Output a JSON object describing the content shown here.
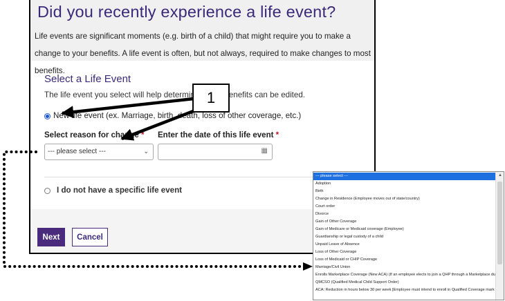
{
  "page": {
    "title": "Did you recently experience a life event?",
    "intro": "Life events are significant moments (e.g. birth of a child) that might require you to make a change to your benefits. A life event is often, but not always, required to make changes to most benefits."
  },
  "section": {
    "heading": "Select a Life Event",
    "subtext": "The life event you select will help determine which benefits can be edited."
  },
  "options": {
    "new_event": "New life event (ex. Marriage, birth, death, loss of other coverage, etc.)",
    "no_event": "I do not have a specific life event"
  },
  "fields": {
    "reason_label": "Select reason for change",
    "date_label": "Enter the date of this life event",
    "required_mark": "*",
    "reason_value": "--- please select ---"
  },
  "buttons": {
    "next": "Next",
    "cancel": "Cancel"
  },
  "callout": {
    "number": "1"
  },
  "dropdown": {
    "items": [
      "--- please select ---",
      "Adoption",
      "Birth",
      "Change in Residence (Employee moves out of state/country)",
      "Court order",
      "Divorce",
      "Gain of Other Coverage",
      "Gain of Medicare or Medicaid coverage (Employee)",
      "Guardianship or legal custody of a child",
      "Unpaid Leave of Absence",
      "Loss of Other Coverage",
      "Loss of Medicaid or CHIP Coverage",
      "Marriage/Civil Union",
      "Enrolls Marketplace Coverage (New ACA) (If an employee elects to join a QHP through a Marketplace dur",
      "QMCSO (Qualified Medical Child Support Order)",
      "ACA: Reduction in hours below 30 per week [Employee must intend to enroll in Qualified Coverage mark"
    ]
  },
  "colors": {
    "brand_purple": "#4a2a7c",
    "title_purple": "#3b2a7a",
    "required_red": "#c0112b",
    "selection_blue": "#1e6fe0"
  }
}
